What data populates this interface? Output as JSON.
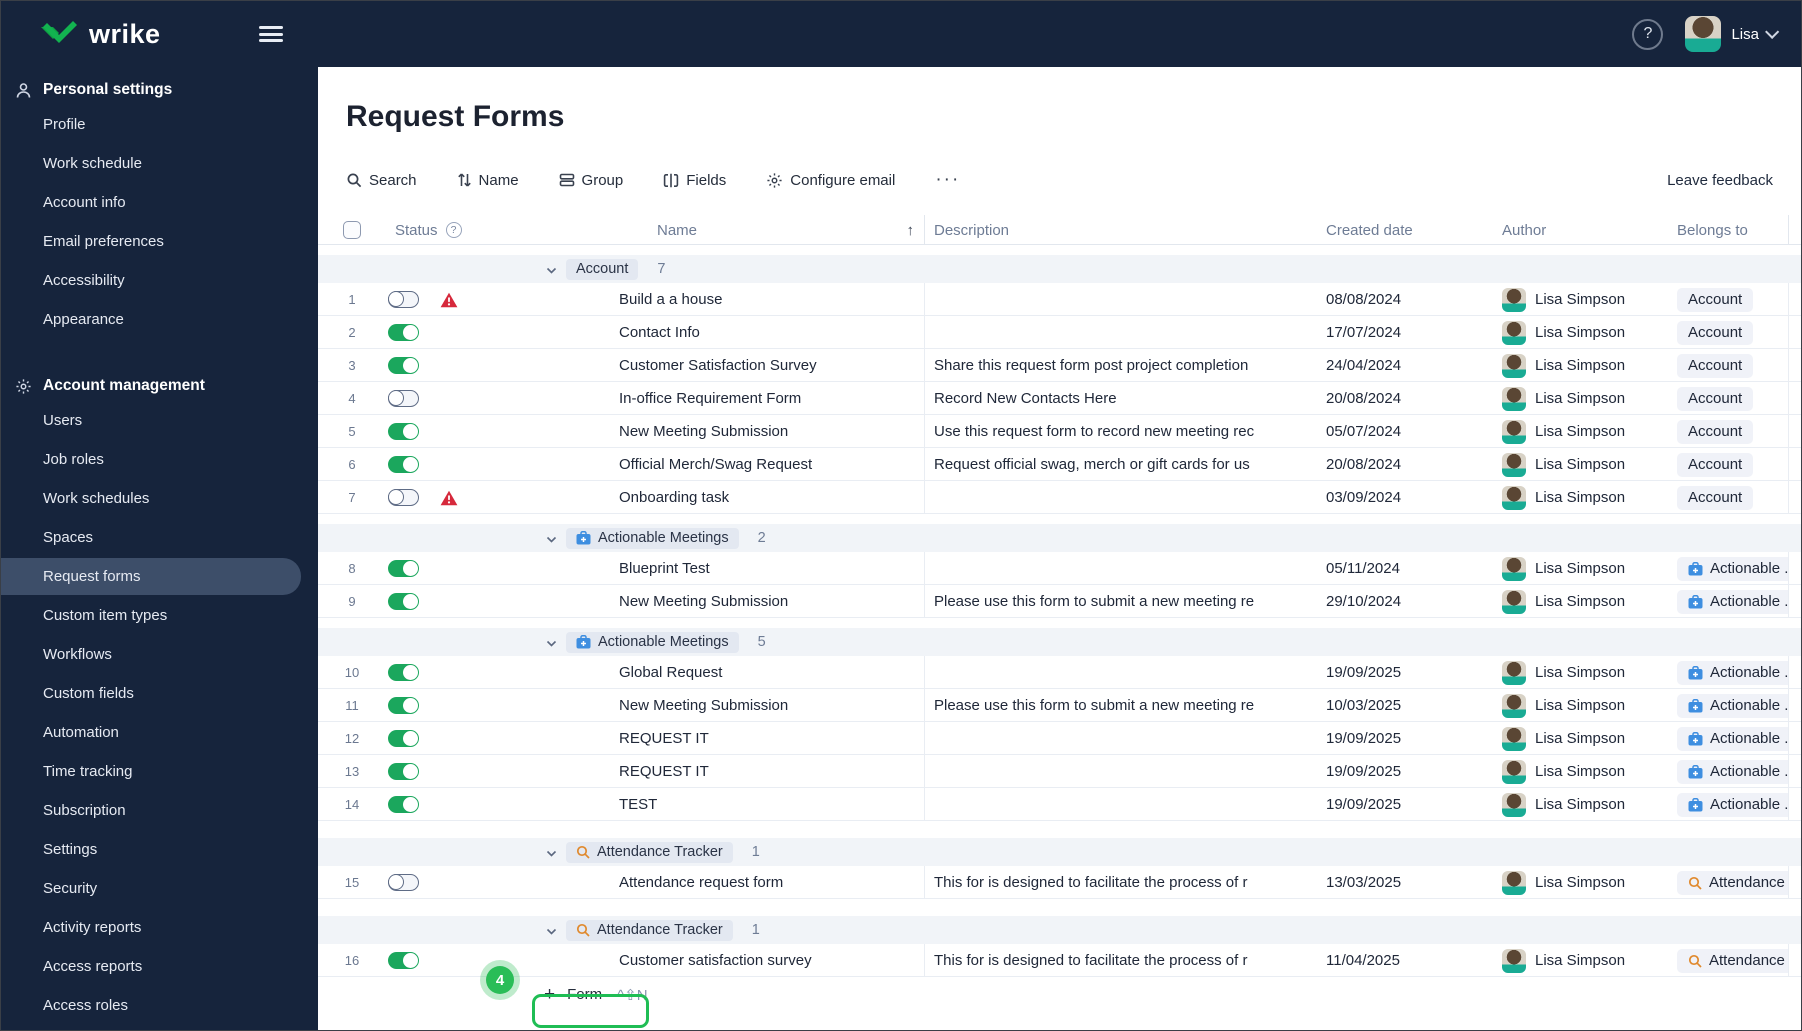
{
  "colors": {
    "brand_navy": "#16243C",
    "sidebar_selected": "#3D4E69",
    "logo_green": "#12B350",
    "toggle_on_green": "#1BA75D",
    "warning_red": "#D6293C",
    "group_band": "#F1F4F8",
    "pill_bg": "#E3E8F1",
    "briefcase_blue": "#3E8EE0",
    "magnifier_orange": "#E0892D",
    "annotation_green": "#22BD50"
  },
  "topbar": {
    "logo_text": "wrike",
    "user_name": "Lisa",
    "help_glyph": "?"
  },
  "sidebar": {
    "sections": [
      {
        "label": "Personal settings",
        "icon": "person-icon",
        "items": [
          "Profile",
          "Work schedule",
          "Account info",
          "Email preferences",
          "Accessibility",
          "Appearance"
        ],
        "selected": ""
      },
      {
        "label": "Account management",
        "icon": "gear-icon",
        "items": [
          "Users",
          "Job roles",
          "Work schedules",
          "Spaces",
          "Request forms",
          "Custom item types",
          "Workflows",
          "Custom fields",
          "Automation",
          "Time tracking",
          "Subscription",
          "Settings",
          "Security",
          "Activity reports",
          "Access reports",
          "Access roles"
        ],
        "selected": "Request forms"
      }
    ]
  },
  "page": {
    "title": "Request Forms"
  },
  "toolbar": {
    "items": [
      {
        "icon": "search-icon",
        "label": "Search"
      },
      {
        "icon": "sort-icon",
        "label": "Name"
      },
      {
        "icon": "group-icon",
        "label": "Group"
      },
      {
        "icon": "fields-icon",
        "label": "Fields"
      },
      {
        "icon": "gear-icon",
        "label": "Configure email"
      }
    ],
    "more_label": "···",
    "leave_feedback": "Leave feedback"
  },
  "table": {
    "header": {
      "status": "Status",
      "name": "Name",
      "description": "Description",
      "created": "Created date",
      "author": "Author",
      "belongs": "Belongs to",
      "sort_glyph": "↑",
      "help_glyph": "?"
    },
    "groups": [
      {
        "label": "Account",
        "icon": null,
        "count": "7",
        "rows": [
          {
            "num": "1",
            "toggle": "off",
            "warning": true,
            "name": "Build a a house",
            "description": "",
            "created": "08/08/2024",
            "author": "Lisa Simpson",
            "belongs": "Account",
            "belongs_icon": null
          },
          {
            "num": "2",
            "toggle": "on",
            "warning": false,
            "name": "Contact Info",
            "description": "",
            "created": "17/07/2024",
            "author": "Lisa Simpson",
            "belongs": "Account",
            "belongs_icon": null
          },
          {
            "num": "3",
            "toggle": "on",
            "warning": false,
            "name": "Customer Satisfaction Survey",
            "description": "Share this request form post project completion",
            "created": "24/04/2024",
            "author": "Lisa Simpson",
            "belongs": "Account",
            "belongs_icon": null
          },
          {
            "num": "4",
            "toggle": "off",
            "warning": false,
            "name": "In-office Requirement Form",
            "description": "Record New Contacts Here",
            "created": "20/08/2024",
            "author": "Lisa Simpson",
            "belongs": "Account",
            "belongs_icon": null
          },
          {
            "num": "5",
            "toggle": "on",
            "warning": false,
            "name": "New Meeting Submission",
            "description": "Use this request form to record new meeting rec",
            "created": "05/07/2024",
            "author": "Lisa Simpson",
            "belongs": "Account",
            "belongs_icon": null
          },
          {
            "num": "6",
            "toggle": "on",
            "warning": false,
            "name": "Official Merch/Swag Request",
            "description": "Request official swag, merch or gift cards for us",
            "created": "20/08/2024",
            "author": "Lisa Simpson",
            "belongs": "Account",
            "belongs_icon": null
          },
          {
            "num": "7",
            "toggle": "off",
            "warning": true,
            "name": "Onboarding task",
            "description": "",
            "created": "03/09/2024",
            "author": "Lisa Simpson",
            "belongs": "Account",
            "belongs_icon": null
          }
        ]
      },
      {
        "label": "Actionable Meetings",
        "icon": "briefcase-icon",
        "count": "2",
        "rows": [
          {
            "num": "8",
            "toggle": "on",
            "warning": false,
            "name": "Blueprint Test",
            "description": "",
            "created": "05/11/2024",
            "author": "Lisa Simpson",
            "belongs": "Actionable ...",
            "belongs_icon": "briefcase-icon"
          },
          {
            "num": "9",
            "toggle": "on",
            "warning": false,
            "name": "New Meeting Submission",
            "description": "Please use this form to submit a new meeting re",
            "created": "29/10/2024",
            "author": "Lisa Simpson",
            "belongs": "Actionable ...",
            "belongs_icon": "briefcase-icon"
          }
        ]
      },
      {
        "label": "Actionable Meetings",
        "icon": "briefcase-icon",
        "count": "5",
        "rows": [
          {
            "num": "10",
            "toggle": "on",
            "warning": false,
            "name": "Global Request",
            "description": "",
            "created": "19/09/2025",
            "author": "Lisa Simpson",
            "belongs": "Actionable ...",
            "belongs_icon": "briefcase-icon"
          },
          {
            "num": "11",
            "toggle": "on",
            "warning": false,
            "name": "New Meeting Submission",
            "description": "Please use this form to submit a new meeting re",
            "created": "10/03/2025",
            "author": "Lisa Simpson",
            "belongs": "Actionable ...",
            "belongs_icon": "briefcase-icon"
          },
          {
            "num": "12",
            "toggle": "on",
            "warning": false,
            "name": "REQUEST IT",
            "description": "",
            "created": "19/09/2025",
            "author": "Lisa Simpson",
            "belongs": "Actionable ...",
            "belongs_icon": "briefcase-icon"
          },
          {
            "num": "13",
            "toggle": "on",
            "warning": false,
            "name": "REQUEST IT",
            "description": "",
            "created": "19/09/2025",
            "author": "Lisa Simpson",
            "belongs": "Actionable ...",
            "belongs_icon": "briefcase-icon"
          },
          {
            "num": "14",
            "toggle": "on",
            "warning": false,
            "name": "TEST",
            "description": "",
            "created": "19/09/2025",
            "author": "Lisa Simpson",
            "belongs": "Actionable ...",
            "belongs_icon": "briefcase-icon"
          }
        ]
      },
      {
        "label": "Attendance Tracker",
        "icon": "magnifier-icon",
        "count": "1",
        "rows": [
          {
            "num": "15",
            "toggle": "off",
            "warning": false,
            "name": "Attendance request form",
            "description": "This for is designed to facilitate the process of r",
            "created": "13/03/2025",
            "author": "Lisa Simpson",
            "belongs": "Attendance",
            "belongs_icon": "magnifier-icon"
          }
        ]
      },
      {
        "label": "Attendance Tracker",
        "icon": "magnifier-icon",
        "count": "1",
        "rows": [
          {
            "num": "16",
            "toggle": "on",
            "warning": false,
            "name": "Customer satisfaction survey",
            "description": "This for is designed to facilitate the process of r",
            "created": "11/04/2025",
            "author": "Lisa Simpson",
            "belongs": "Attendance",
            "belongs_icon": "magnifier-icon"
          }
        ]
      }
    ]
  },
  "footer": {
    "plus_glyph": "+",
    "form_label": "Form",
    "shortcut": "^⇧N",
    "annotation_badge": "4"
  }
}
